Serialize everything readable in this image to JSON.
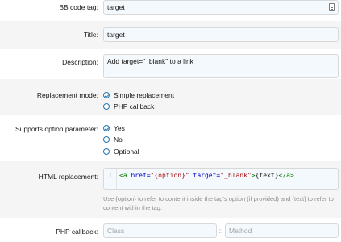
{
  "fields": {
    "bb_code_tag": {
      "label": "BB code tag:",
      "value": "target"
    },
    "title": {
      "label": "Title:",
      "value": "target"
    },
    "description": {
      "label": "Description:",
      "value": "Add target=\"_blank\" to a link"
    },
    "replacement_mode": {
      "label": "Replacement mode:",
      "options": [
        {
          "label": "Simple replacement",
          "checked": true
        },
        {
          "label": "PHP callback",
          "checked": false
        }
      ]
    },
    "supports_option": {
      "label": "Supports option parameter:",
      "options": [
        {
          "label": "Yes",
          "checked": true
        },
        {
          "label": "No",
          "checked": false
        },
        {
          "label": "Optional",
          "checked": false
        }
      ]
    },
    "html_replacement": {
      "label": "HTML replacement:",
      "line_number": "1",
      "code_tokens": {
        "open": "<a",
        "attr1": " href=",
        "str1": "\"{option}\"",
        "attr2": " target=",
        "str2": "\"_blank\"",
        "close": ">",
        "text": "{text}",
        "end": "</a>"
      },
      "hint": "Use {option} to refer to content inside the tag's option (if provided) and {text} to refer to content within the tag."
    },
    "php_callback": {
      "label": "PHP callback:",
      "class_placeholder": "Class",
      "separator": "::",
      "method_placeholder": "Method"
    }
  },
  "colors": {
    "accent": "#2577b1",
    "input_bg": "#f4f9fd",
    "band_bg": "#f5f5f5"
  },
  "icons": {
    "bb_code_field": "document-icon"
  }
}
